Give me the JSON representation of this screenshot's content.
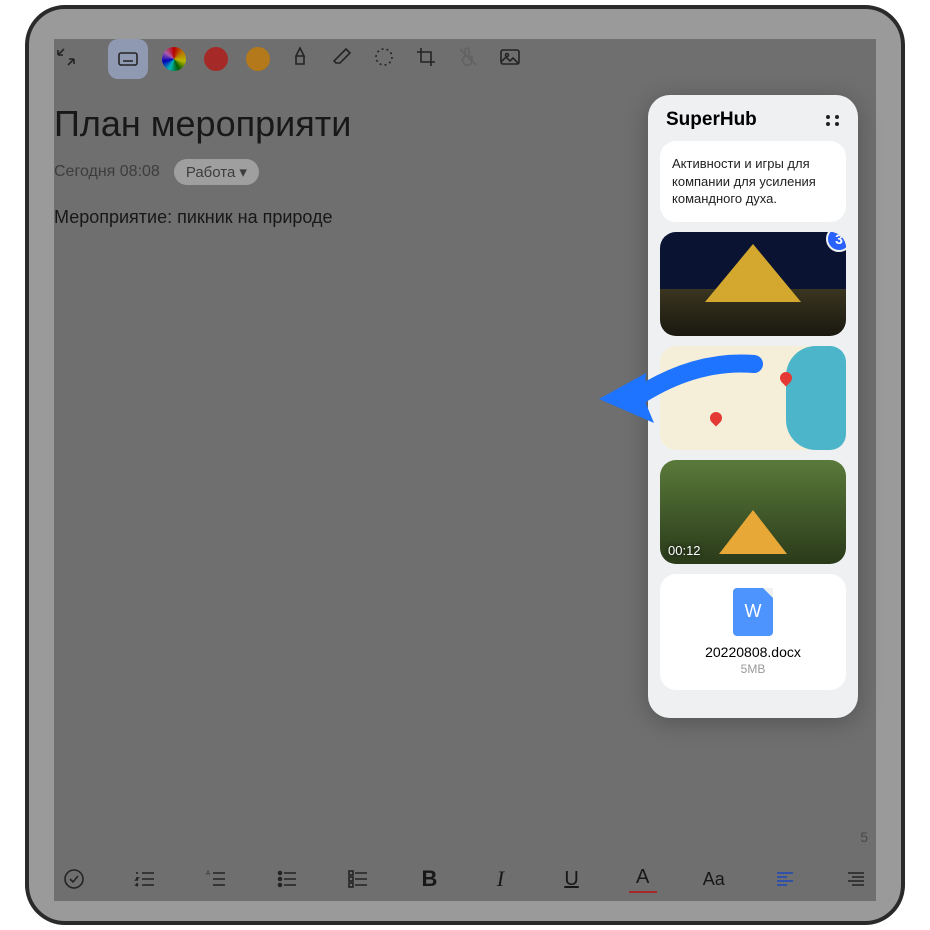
{
  "note": {
    "title": "План мероприяти",
    "timestamp": "Сегодня 08:08",
    "tag": "Работа",
    "body": "Мероприятие: пикник на природе",
    "page_number": "5"
  },
  "superhub": {
    "title": "SuperHub",
    "text_card": "Активности и игры для компании для усиления командного духа.",
    "image_stack_badge": "3",
    "video_duration": "00:12",
    "file": {
      "name": "20220808.docx",
      "size": "5MB",
      "icon_letter": "W"
    }
  },
  "format": {
    "bold": "B",
    "italic": "I",
    "underline": "U",
    "color": "A",
    "font": "Aa"
  }
}
